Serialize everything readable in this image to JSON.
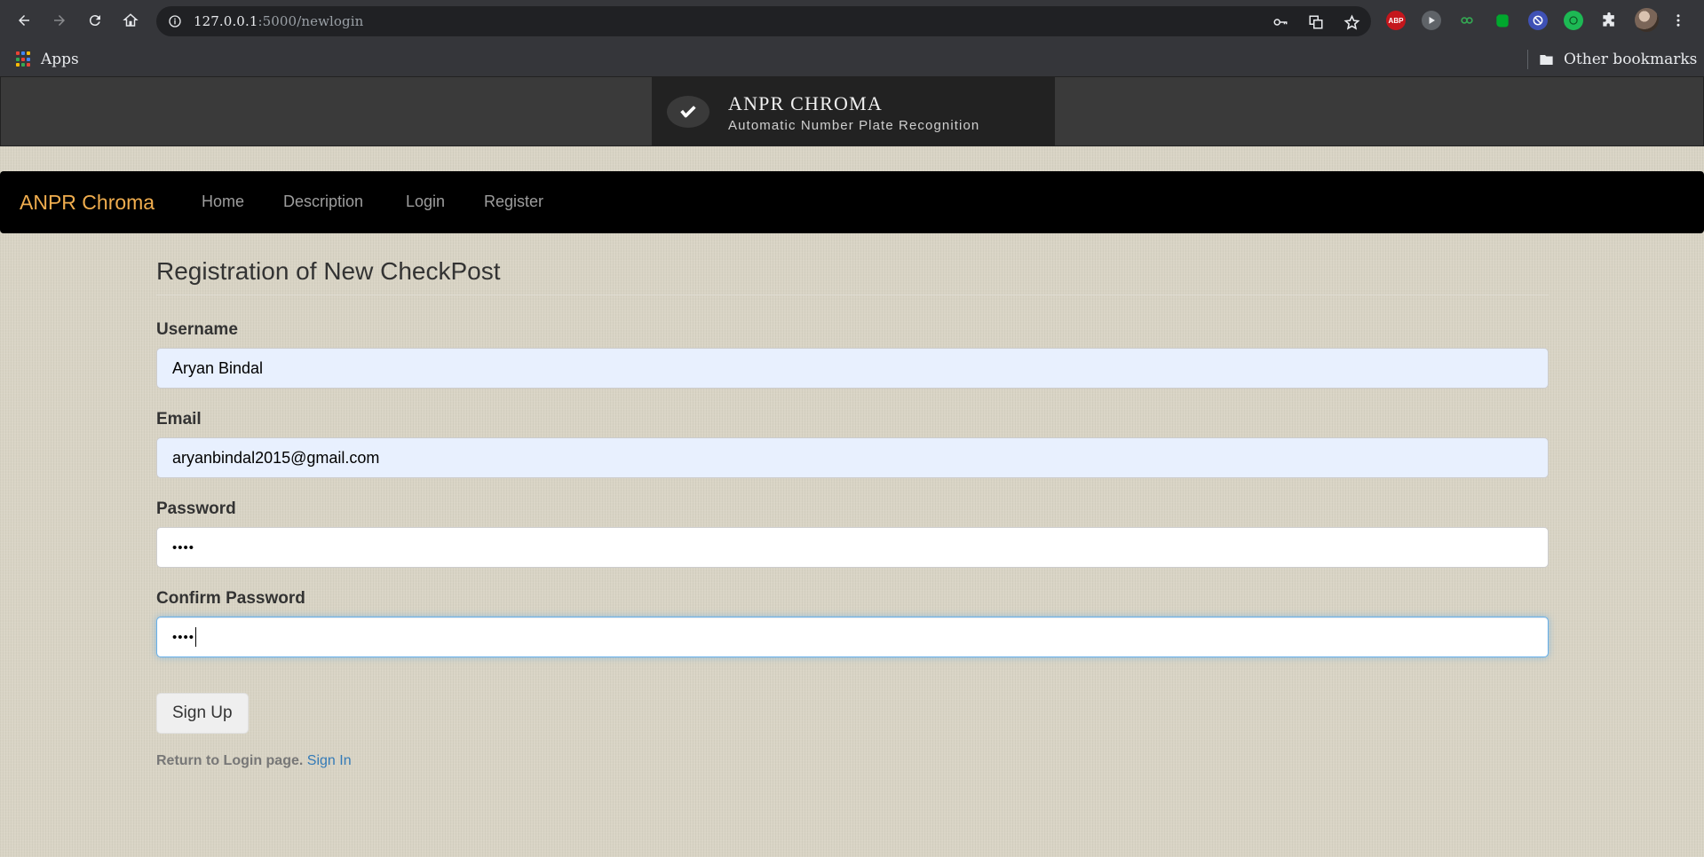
{
  "browser": {
    "url_host": "127.0.0.1",
    "url_path": ":5000/newlogin",
    "bookmarks": {
      "apps_label": "Apps",
      "other_label": "Other bookmarks"
    },
    "extensions": [
      "abp-icon",
      "play-icon",
      "infinity-icon",
      "evernote-icon",
      "blocker-icon",
      "green-circle-icon",
      "puzzle-icon",
      "avatar"
    ],
    "abp_label": "ABP"
  },
  "banner": {
    "title": "ANPR CHROMA",
    "subtitle": "Automatic Number Plate Recognition"
  },
  "navbar": {
    "brand": "ANPR Chroma",
    "links": [
      "Home",
      "Description",
      "Login",
      "Register"
    ]
  },
  "form": {
    "legend": "Registration of New CheckPost",
    "username_label": "Username",
    "username_value": "Aryan Bindal",
    "email_label": "Email",
    "email_value": "aryanbindal2015@gmail.com",
    "password_label": "Password",
    "password_value": "••••",
    "confirm_label": "Confirm Password",
    "confirm_value": "••••",
    "submit_label": "Sign Up",
    "return_text": "Return to Login page.",
    "signin_link": "Sign In"
  },
  "colors": {
    "brand": "#f0ad4e",
    "link": "#337ab7",
    "navbar_bg": "#000000",
    "autofill_bg": "#e8f0fe",
    "focus_border": "#66afe9"
  }
}
